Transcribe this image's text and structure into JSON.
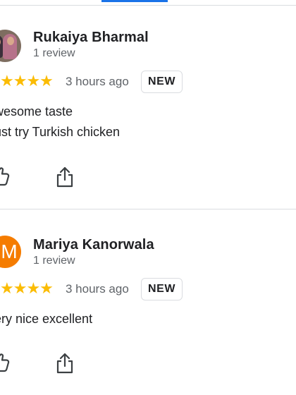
{
  "colors": {
    "accent": "#1a73e8",
    "star": "#fbbc04",
    "avatar_orange": "#f57c00"
  },
  "reviews": [
    {
      "name": "Rukaiya Bharmal",
      "meta": "1 review",
      "stars": "★★★★",
      "rating": 4,
      "time": "3 hours ago",
      "badge": "NEW",
      "lines": [
        "wesome taste",
        "ust try Turkish chicken"
      ],
      "avatar": "photo-avatar"
    },
    {
      "name": "Mariya Kanorwala",
      "meta": "1 review",
      "stars": "★★★★",
      "rating": 4,
      "time": "3 hours ago",
      "badge": "NEW",
      "lines": [
        "ery nice excellent"
      ],
      "avatar_letter": "M"
    }
  ],
  "icons": {
    "like": "thumbs-up-icon",
    "share": "share-icon"
  }
}
